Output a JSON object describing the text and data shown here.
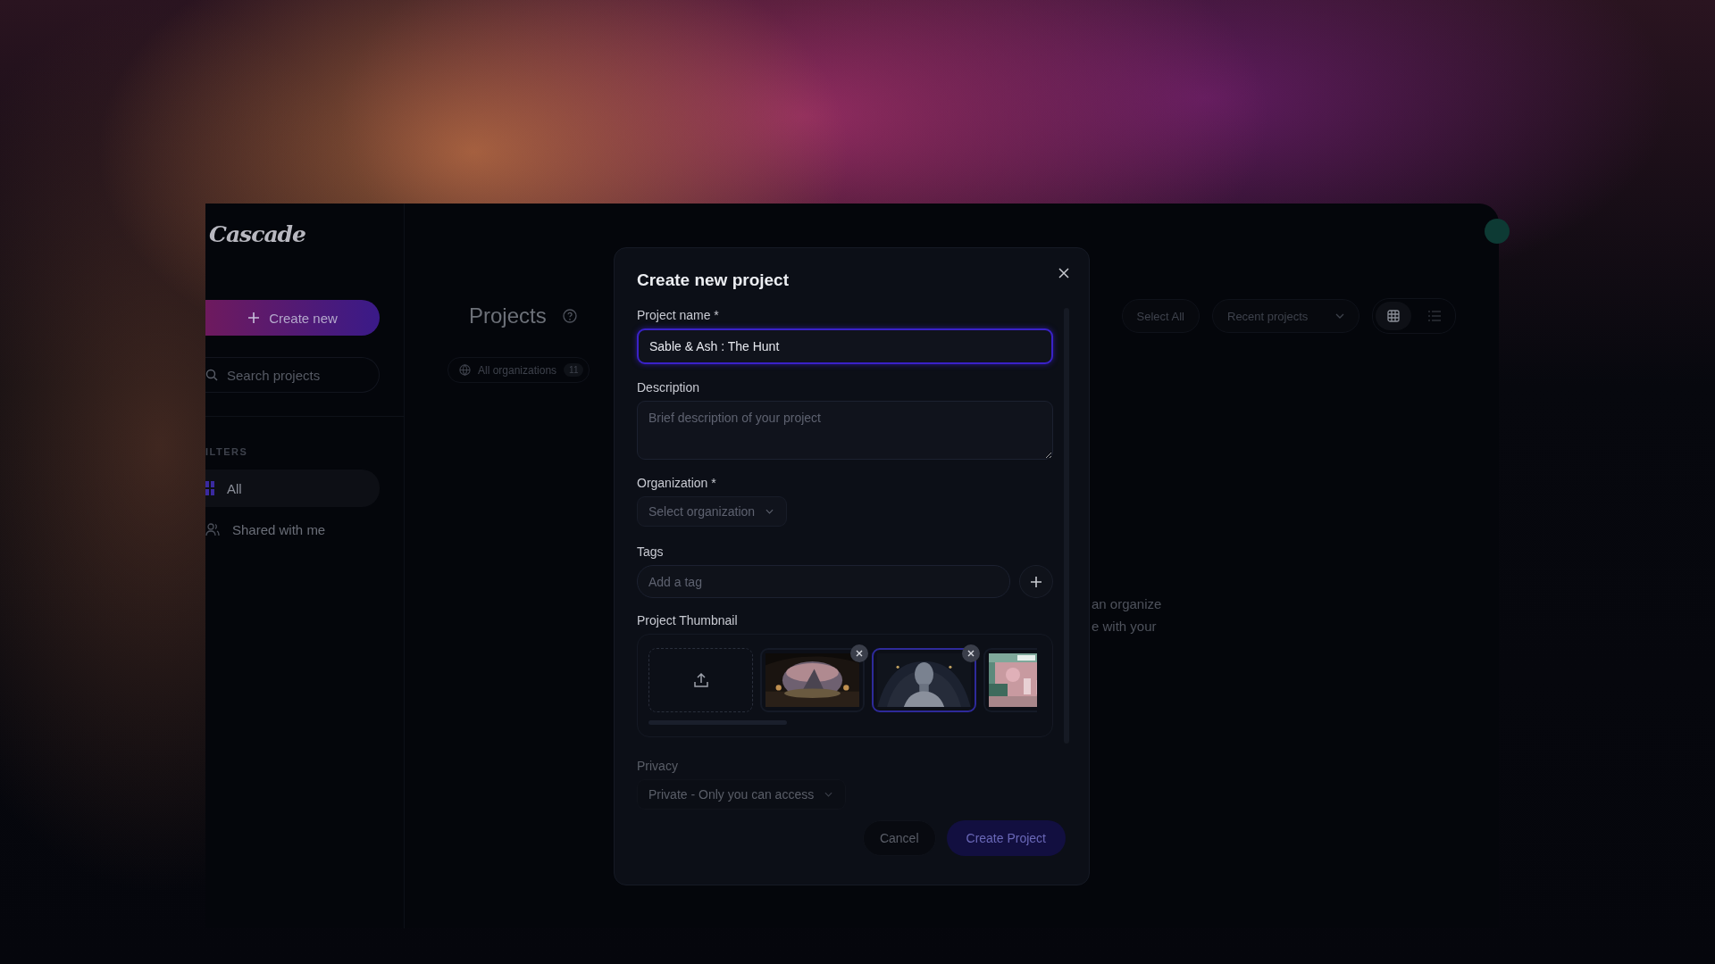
{
  "app": {
    "logo": "Cascade"
  },
  "sidebar": {
    "create_button": "Create new",
    "search": {
      "placeholder": "Search projects"
    },
    "section_label": "ILTERS",
    "items": [
      {
        "label": "All",
        "kind": "grid",
        "selected": true
      },
      {
        "label": "Shared with me",
        "kind": "people",
        "selected": false
      }
    ]
  },
  "main": {
    "title": "Projects",
    "filter_chip": {
      "label": "All organizations",
      "count": "11"
    },
    "toolbar": {
      "select_all": "Select All",
      "sort": "Recent projects",
      "views": [
        {
          "kind": "grid",
          "selected": true
        },
        {
          "kind": "list",
          "selected": false
        }
      ]
    },
    "empty_text": [
      "an organize",
      "e with your"
    ]
  },
  "dialog": {
    "title": "Create new project",
    "name": {
      "label": "Project name *",
      "value": "Sable & Ash : The Hunt",
      "focused": true
    },
    "description": {
      "label": "Description",
      "placeholder": "Brief description of your project"
    },
    "organization": {
      "label": "Organization *",
      "placeholder": "Select organization"
    },
    "tags": {
      "label": "Tags",
      "placeholder": "Add a tag"
    },
    "thumbnail": {
      "label": "Project Thumbnail",
      "items": [
        {
          "kind": "upload"
        },
        {
          "kind": "picture",
          "selected": false,
          "removable": true
        },
        {
          "kind": "picture",
          "selected": true,
          "removable": true
        },
        {
          "kind": "picture",
          "selected": false,
          "removable": false
        }
      ]
    },
    "privacy": {
      "label": "Privacy",
      "value": "Private - Only you can access"
    },
    "buttons": [
      {
        "label": "Cancel",
        "kind": "secondary",
        "disabled": false
      },
      {
        "label": "Create Project",
        "kind": "primary",
        "disabled": true
      }
    ]
  }
}
